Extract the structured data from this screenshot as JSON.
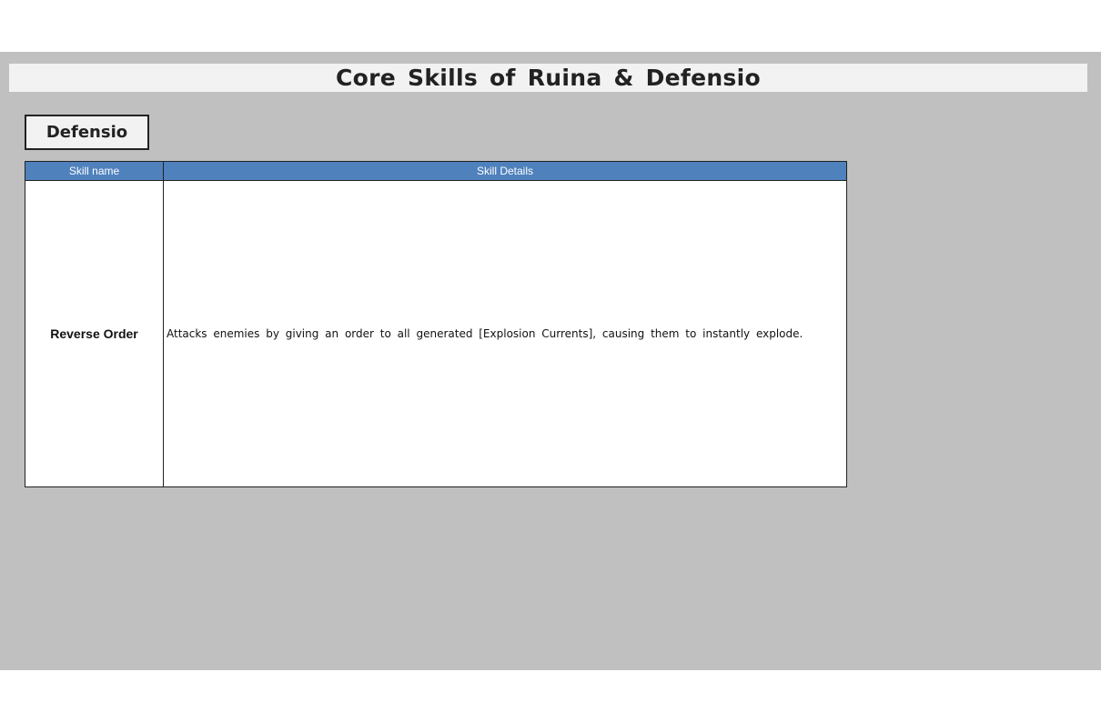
{
  "page": {
    "title": "Core Skills of Ruina & Defensio",
    "section_label": "Defensio"
  },
  "table": {
    "headers": {
      "skill_name": "Skill name",
      "skill_details": "Skill Details"
    },
    "rows": [
      {
        "skill_name": "Reverse Order",
        "skill_details": "Attacks enemies by giving an order to all generated [Explosion Currents], causing them to instantly explode."
      }
    ]
  },
  "colors": {
    "background_panel": "#c0c0c0",
    "title_bar": "#f2f2f2",
    "table_header": "#4f81bd",
    "table_header_text": "#ffffff",
    "cell_background": "#ffffff"
  }
}
